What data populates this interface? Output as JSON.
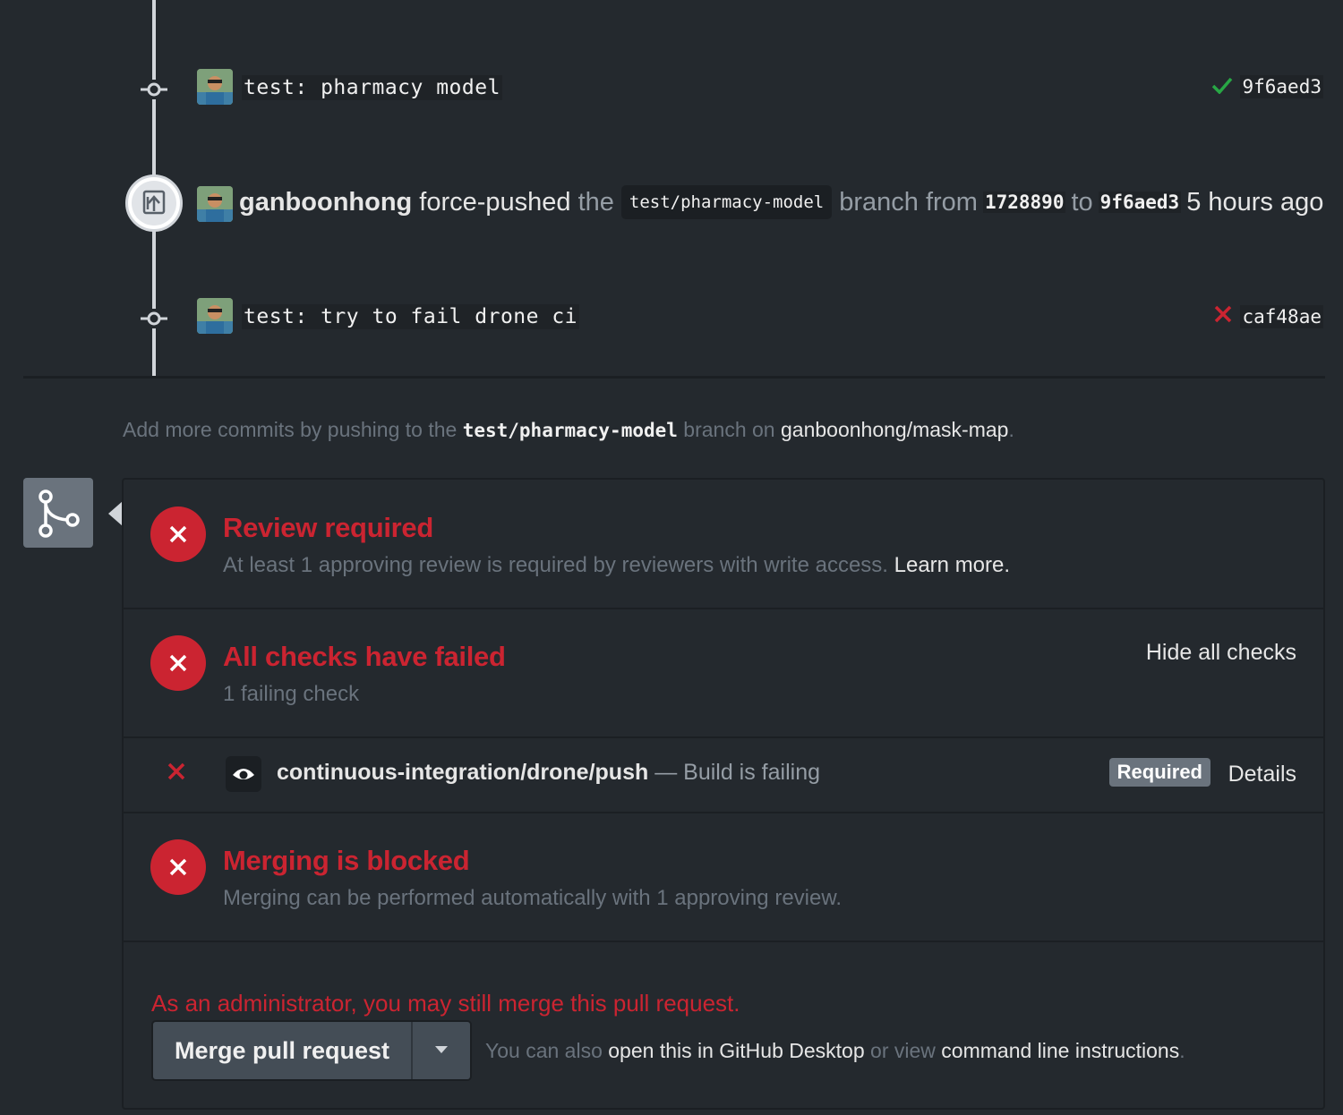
{
  "timeline": {
    "commits": [
      {
        "message": "test: pharmacy model",
        "sha": "9f6aed3",
        "status": "success",
        "status_color": "#28a745"
      },
      {
        "message": "test: try to fail drone ci",
        "sha": "caf48ae",
        "status": "failure",
        "status_color": "#cb2431"
      }
    ],
    "force_push": {
      "actor": "ganboonhong",
      "action": "force-pushed",
      "the": "the",
      "branch": "test/pharmacy-model",
      "branch_from": "branch from",
      "from_sha": "1728890",
      "to": "to",
      "to_sha": "9f6aed3",
      "time": "5 hours ago"
    }
  },
  "hint": {
    "prefix": "Add more commits by pushing to the",
    "branch": "test/pharmacy-model",
    "middle": "branch on",
    "repo": "ganboonhong/mask-map",
    "suffix": "."
  },
  "merge_box": {
    "review": {
      "title": "Review required",
      "desc": "At least 1 approving review is required by reviewers with write access.",
      "link": "Learn more."
    },
    "checks": {
      "title": "All checks have failed",
      "desc": "1 failing check",
      "toggle": "Hide all checks"
    },
    "check_item": {
      "context": "continuous-integration/drone/push",
      "description": "— Build is failing",
      "badge": "Required",
      "details": "Details"
    },
    "blocked": {
      "title": "Merging is blocked",
      "desc": "Merging can be performed automatically with 1 approving review."
    },
    "admin": {
      "note": "As an administrator, you may still merge this pull request.",
      "button": "Merge pull request",
      "alt_prefix": "You can also",
      "alt_link1": "open this in GitHub Desktop",
      "alt_or": "or view",
      "alt_link2": "command line instructions",
      "alt_suffix": "."
    }
  },
  "colors": {
    "background": "#24292e",
    "danger": "#cb2431",
    "success": "#28a745",
    "muted": "#6a737d"
  }
}
